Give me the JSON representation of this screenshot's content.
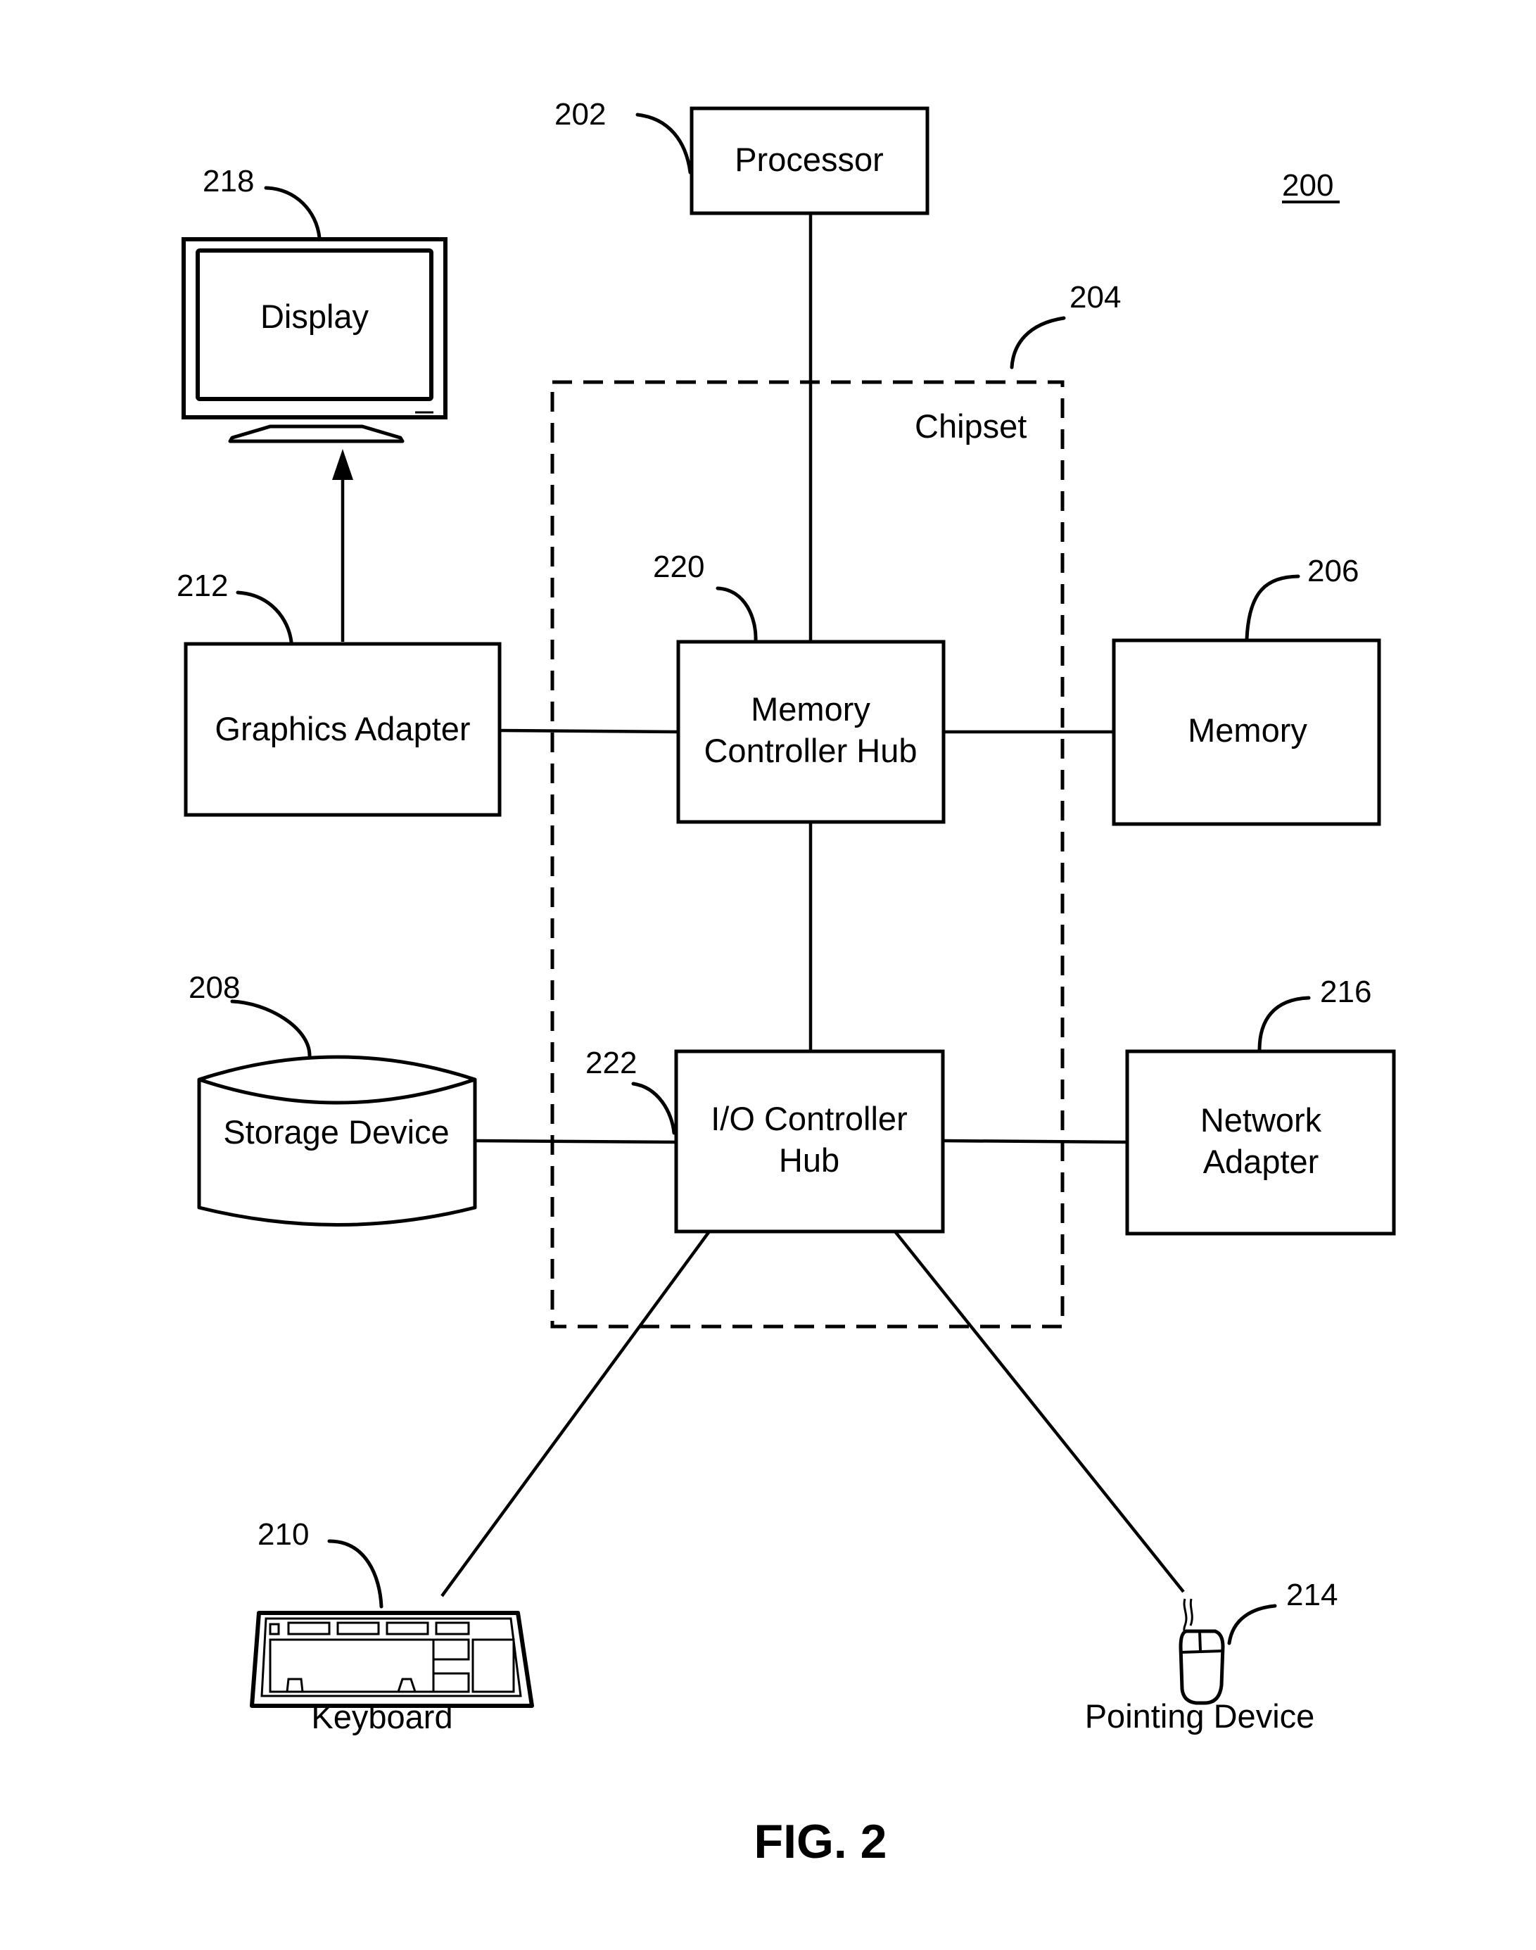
{
  "figure": {
    "caption": "FIG. 2",
    "system_ref": "200"
  },
  "components": {
    "processor": {
      "label": "Processor",
      "ref": "202"
    },
    "chipset": {
      "label": "Chipset",
      "ref": "204"
    },
    "memory": {
      "label": "Memory",
      "ref": "206"
    },
    "storage": {
      "label": "Storage Device",
      "ref": "208"
    },
    "keyboard": {
      "label": "Keyboard",
      "ref": "210"
    },
    "graphics_adapter": {
      "label": "Graphics Adapter",
      "ref": "212"
    },
    "pointing_device": {
      "label": "Pointing Device",
      "ref": "214"
    },
    "network_adapter": {
      "label_line1": "Network",
      "label_line2": "Adapter",
      "ref": "216"
    },
    "display": {
      "label": "Display",
      "ref": "218"
    },
    "memory_controller_hub": {
      "label_line1": "Memory",
      "label_line2": "Controller Hub",
      "ref": "220"
    },
    "io_controller_hub": {
      "label_line1": "I/O Controller",
      "label_line2": "Hub",
      "ref": "222"
    }
  },
  "connections": [
    [
      "processor",
      "memory_controller_hub"
    ],
    [
      "graphics_adapter",
      "memory_controller_hub"
    ],
    [
      "memory_controller_hub",
      "memory"
    ],
    [
      "memory_controller_hub",
      "io_controller_hub"
    ],
    [
      "graphics_adapter",
      "display"
    ],
    [
      "storage",
      "io_controller_hub"
    ],
    [
      "io_controller_hub",
      "network_adapter"
    ],
    [
      "io_controller_hub",
      "keyboard"
    ],
    [
      "io_controller_hub",
      "pointing_device"
    ]
  ]
}
